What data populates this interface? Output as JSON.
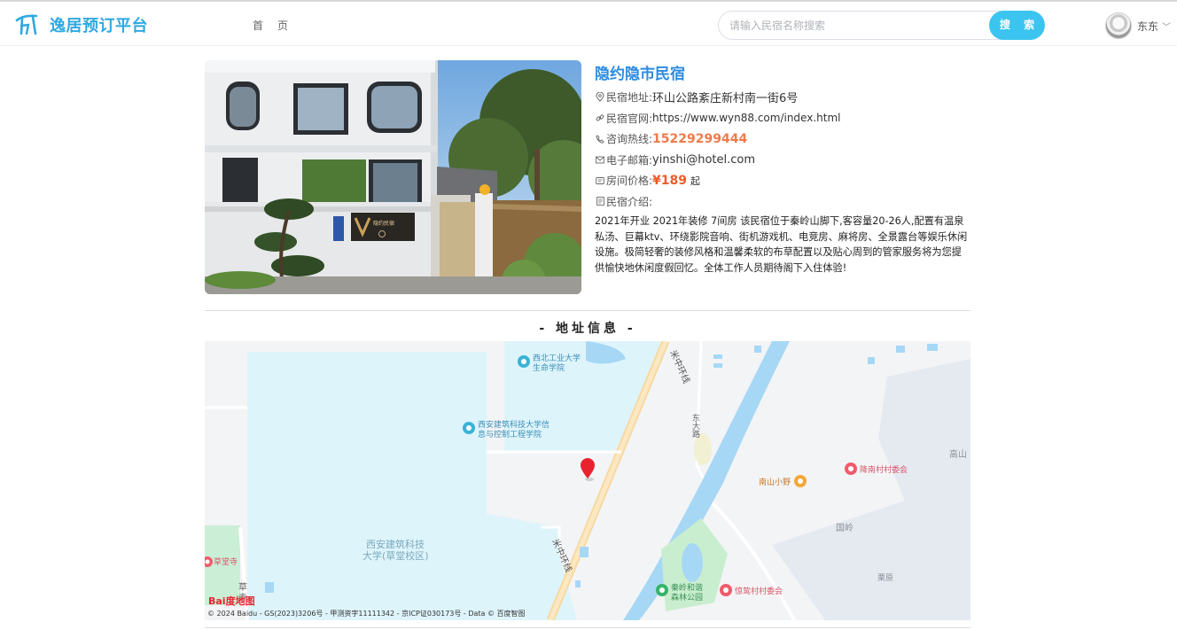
{
  "header": {
    "brand": "逸居预订平台",
    "nav_home": "首页",
    "search_placeholder": "请输入民宿名称搜索",
    "search_button": "搜 索",
    "user_name": "东东"
  },
  "hotel": {
    "name": "隐约隐市民宿",
    "address_label": "民宿地址:",
    "address": "环山公路紊庄新村南一街6号",
    "website_label": "民宿官网:",
    "website": "https://www.wyn88.com/index.html",
    "phone_label": "咨询热线:",
    "phone": "15229299444",
    "email_label": "电子邮箱:",
    "email": "yinshi@hotel.com",
    "price_label": "房间价格:",
    "price": "¥189",
    "price_unit": "起",
    "intro_label": "民宿介绍:",
    "intro": "2021年开业 2021年装修 7间房 该民宿位于秦岭山脚下,客容量20-26人,配置有温泉私汤、巨幕ktv、环绕影院音响、街机游戏机、电竞房、麻将房、全景露台等娱乐休闲设施。极简轻奢的装修风格和温馨柔软的布草配置以及贴心周到的管家服务将为您提供愉快地休闲度假回忆。全体工作人员期待阁下入住体验!",
    "photo_sign": "隐约民宿"
  },
  "map_section": {
    "title": "- 地址信息 -"
  },
  "map": {
    "labels": {
      "nwpu": "西北工业大学",
      "nwpu2": "生命学院",
      "xauat_info": "西安建筑科技大学信",
      "xauat_info2": "息与控制工程学院",
      "xauat_campus": "西安建筑科技",
      "xauat_campus2": "大学(草堂校区)",
      "road1": "米中环线",
      "road2": "米中环线",
      "east_road": "东大路",
      "nanshan": "南山小野",
      "jiangnan": "降南村村委会",
      "gaoshan": "高山",
      "guoling": "国岭",
      "liyuan": "栗原",
      "qinling_park": "秦岭和谐",
      "qinling_park2": "森林公园",
      "jingzhi": "惊鸷村村委会",
      "caotang_temple": "草堂寺",
      "cao": "草",
      "si": "寺"
    },
    "logo": "Bai度地图",
    "copyright": "© 2024 Baidu - GS(2023)3206号 - 甲测资字11111342 - 京ICP证030173号 - Data © 百度智图"
  },
  "colors": {
    "brand": "#2fa8e0",
    "accent": "#3cc4f0",
    "price": "#f05a28",
    "phone": "#f07a4a"
  }
}
